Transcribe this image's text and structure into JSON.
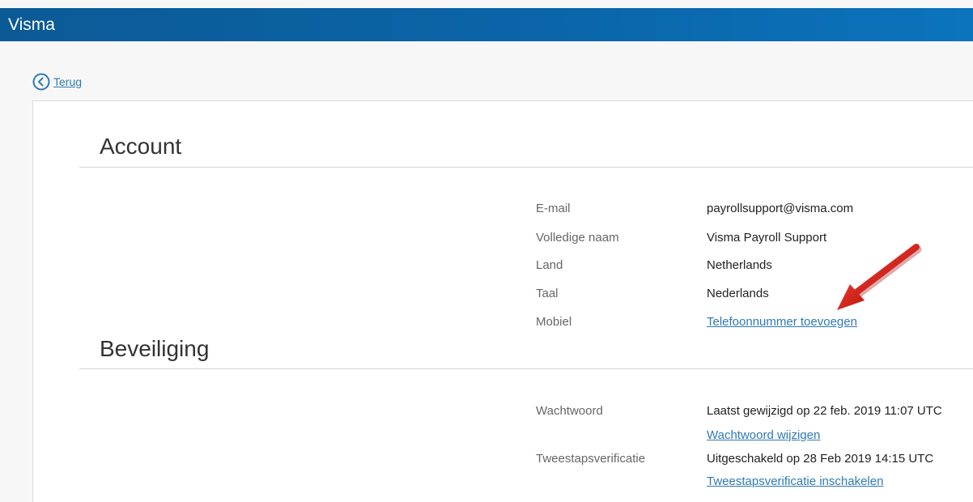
{
  "header": {
    "brand": "Visma",
    "color": "#0b66aa"
  },
  "back": {
    "label": "Terug",
    "icon": "chevron-left-circle-icon"
  },
  "account": {
    "title": "Account",
    "fields": [
      {
        "label": "E-mail",
        "value": "payrollsupport@visma.com"
      },
      {
        "label": "Volledige naam",
        "value": "Visma Payroll Support"
      },
      {
        "label": "Land",
        "value": "Netherlands"
      },
      {
        "label": "Taal",
        "value": "Nederlands"
      },
      {
        "label": "Mobiel",
        "link": "Telefoonnummer toevoegen"
      }
    ]
  },
  "security": {
    "title": "Beveiliging",
    "password": {
      "label": "Wachtwoord",
      "value": "Laatst gewijzigd op 22 feb. 2019 11:07 UTC",
      "link": "Wachtwoord wijzigen"
    },
    "twofactor": {
      "label": "Tweestapsverificatie",
      "value": "Uitgeschakeld op 28 Feb 2019 14:15 UTC",
      "link": "Tweestapsverificatie inschakelen"
    }
  },
  "annotation": {
    "icon": "red-arrow-icon",
    "color": "#e0201b"
  }
}
